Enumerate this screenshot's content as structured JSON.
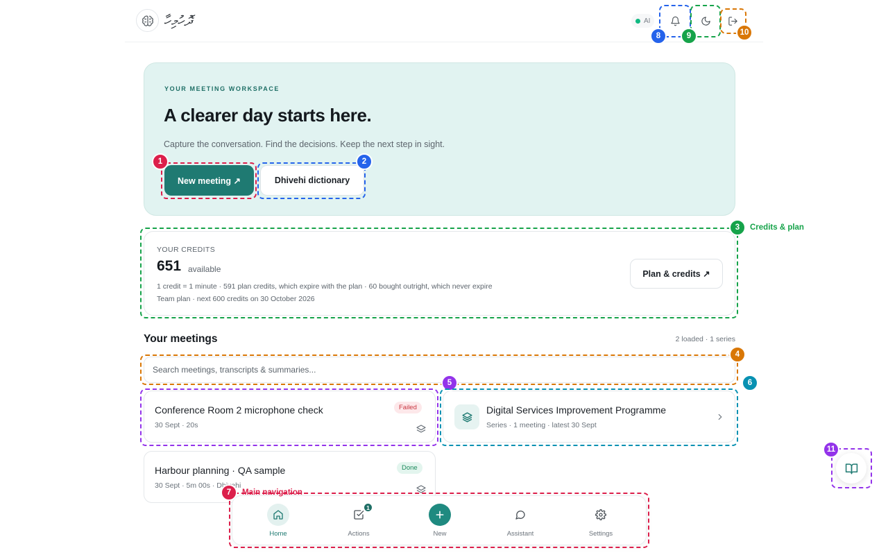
{
  "header": {
    "brand": "ދޮހުމިހާ",
    "ai_label": "AI",
    "icons": [
      "brain-logo-icon",
      "bell-icon",
      "moon-icon",
      "logout-icon"
    ]
  },
  "hero": {
    "eyebrow": "YOUR MEETING WORKSPACE",
    "title": "A clearer day starts here.",
    "subtitle": "Capture the conversation. Find the decisions. Keep the next step in sight.",
    "primary_button": "New meeting ↗",
    "secondary_button": "Dhivehi dictionary"
  },
  "credits": {
    "label": "YOUR CREDITS",
    "amount": "651",
    "unit": "available",
    "line1": "1 credit = 1 minute · 591 plan credits, which expire with the plan · 60 bought outright, which never expire",
    "line2": "Team plan · next 600 credits on 30 October 2026",
    "button": "Plan & credits ↗"
  },
  "meetings": {
    "title": "Your meetings",
    "meta": "2 loaded · 1 series",
    "search_placeholder": "Search meetings, transcripts & summaries...",
    "items": [
      {
        "title": "Conference Room 2 microphone check",
        "meta": "30 Sept · 20s",
        "status": "Failed"
      },
      {
        "title": "Harbour planning · QA sample",
        "meta": "30 Sept · 5m 00s · Dhivehi",
        "status": "Done"
      }
    ],
    "series": {
      "title": "Digital Services Improvement Programme",
      "meta": "Series · 1 meeting · latest 30 Sept"
    }
  },
  "nav": {
    "items": [
      {
        "label": "Home",
        "icon": "home-icon"
      },
      {
        "label": "Actions",
        "icon": "checkbox-icon",
        "badge": "1"
      },
      {
        "label": "New",
        "icon": "plus-icon"
      },
      {
        "label": "Assistant",
        "icon": "chat-bubble-icon"
      },
      {
        "label": "Settings",
        "icon": "gear-icon"
      }
    ]
  },
  "annotations": {
    "n1": "1",
    "n2": "2",
    "n3": "3",
    "n4": "4",
    "n5": "5",
    "n6": "6",
    "n7": "7",
    "n8": "8",
    "n9": "9",
    "n10": "10",
    "n11": "11",
    "label3": "Credits & plan",
    "label7": "Main navigation"
  },
  "colors": {
    "accent": "#1f7a72",
    "hero_bg": "#e1f3f1",
    "failed": "#c8343f",
    "done": "#1d8a5c"
  }
}
